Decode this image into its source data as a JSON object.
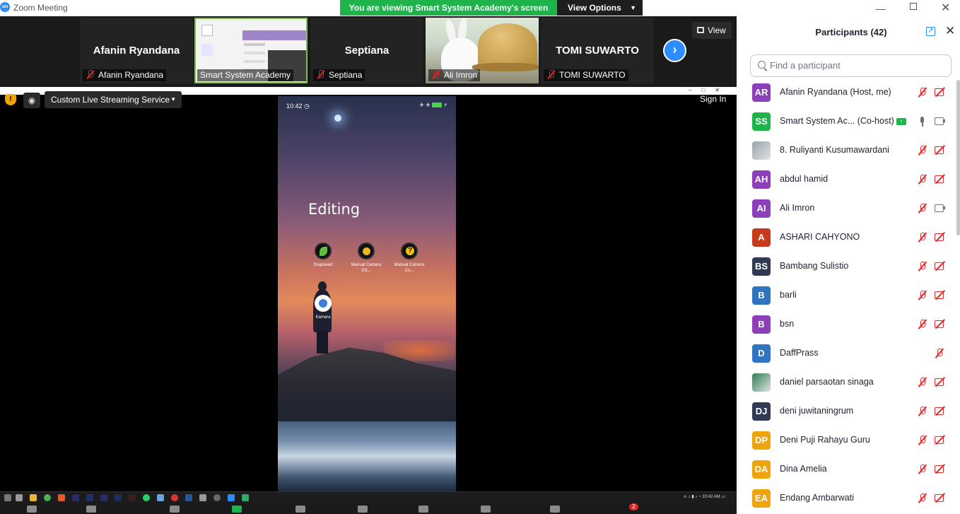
{
  "app": {
    "title": "Zoom Meeting",
    "logo": "zm"
  },
  "banner": {
    "text": "You are viewing Smart System Academy's screen",
    "view_options": "View Options"
  },
  "thumbnails": [
    {
      "big_name": "Afanin Ryandana",
      "tag": "Afanin Ryandana"
    },
    {
      "big_name": "",
      "tag": "Smart System Academy"
    },
    {
      "big_name": "Septiana",
      "tag": "Septiana"
    },
    {
      "big_name": "",
      "tag": "Ali Imron"
    },
    {
      "big_name": "TOMI SUWARTO",
      "tag": "TOMI SUWARTO"
    }
  ],
  "view_button": "View",
  "share_toolbar": {
    "stream_label": "Custom Live Streaming Service",
    "sign_in": "Sign In"
  },
  "phone": {
    "time": "10:42",
    "heading": "Editing",
    "apps": [
      {
        "label": "Snapseed"
      },
      {
        "label": "Manual Camera DS..."
      },
      {
        "label": "Manual Camera Co..."
      },
      {
        "label": "Kamera"
      }
    ]
  },
  "taskbar": {
    "clock": "10:42 AM"
  },
  "meeting_controls": {
    "chat_badge": "2"
  },
  "panel": {
    "title": "Participants (42)",
    "search_placeholder": "Find a participant",
    "participants": [
      {
        "initials": "AR",
        "name": "Afanin Ryandana (Host, me)",
        "color": "#8c3fb8",
        "mic": "muted",
        "video": "off"
      },
      {
        "initials": "SS",
        "name": "Smart System Ac...  (Co-host)",
        "color": "#1fb34b",
        "mic": "on",
        "video": "on",
        "sharing": true
      },
      {
        "initials": "",
        "name": "8. Ruliyanti Kusumawardani",
        "color": "#9aa4ac",
        "mic": "muted",
        "video": "off",
        "photo": true
      },
      {
        "initials": "AH",
        "name": "abdul hamid",
        "color": "#8c3fb8",
        "mic": "muted",
        "video": "off"
      },
      {
        "initials": "AI",
        "name": "Ali Imron",
        "color": "#8c3fb8",
        "mic": "muted",
        "video": "on"
      },
      {
        "initials": "A",
        "name": "ASHARI CAHYONO",
        "color": "#c53a1a",
        "mic": "muted",
        "video": "off"
      },
      {
        "initials": "BS",
        "name": "Bambang Sulistio",
        "color": "#2f3b52",
        "mic": "muted",
        "video": "off"
      },
      {
        "initials": "B",
        "name": "barli",
        "color": "#2f74c0",
        "mic": "muted",
        "video": "off"
      },
      {
        "initials": "B",
        "name": "bsn",
        "color": "#8c3fb8",
        "mic": "muted",
        "video": "off"
      },
      {
        "initials": "D",
        "name": "DaffPrass",
        "color": "#2f74c0",
        "mic": "muted",
        "video": "none"
      },
      {
        "initials": "",
        "name": "daniel  parsaotan sinaga",
        "color": "#2e7d4f",
        "mic": "muted",
        "video": "off",
        "photo": true
      },
      {
        "initials": "DJ",
        "name": "deni juwitaningrum",
        "color": "#2f3b52",
        "mic": "muted",
        "video": "off"
      },
      {
        "initials": "DP",
        "name": "Deni Puji Rahayu Guru",
        "color": "#f0a40b",
        "mic": "muted",
        "video": "off"
      },
      {
        "initials": "DA",
        "name": "Dina Amelia",
        "color": "#f0a40b",
        "mic": "muted",
        "video": "off"
      },
      {
        "initials": "EA",
        "name": "Endang Ambarwati",
        "color": "#f0a40b",
        "mic": "muted",
        "video": "off"
      }
    ]
  }
}
